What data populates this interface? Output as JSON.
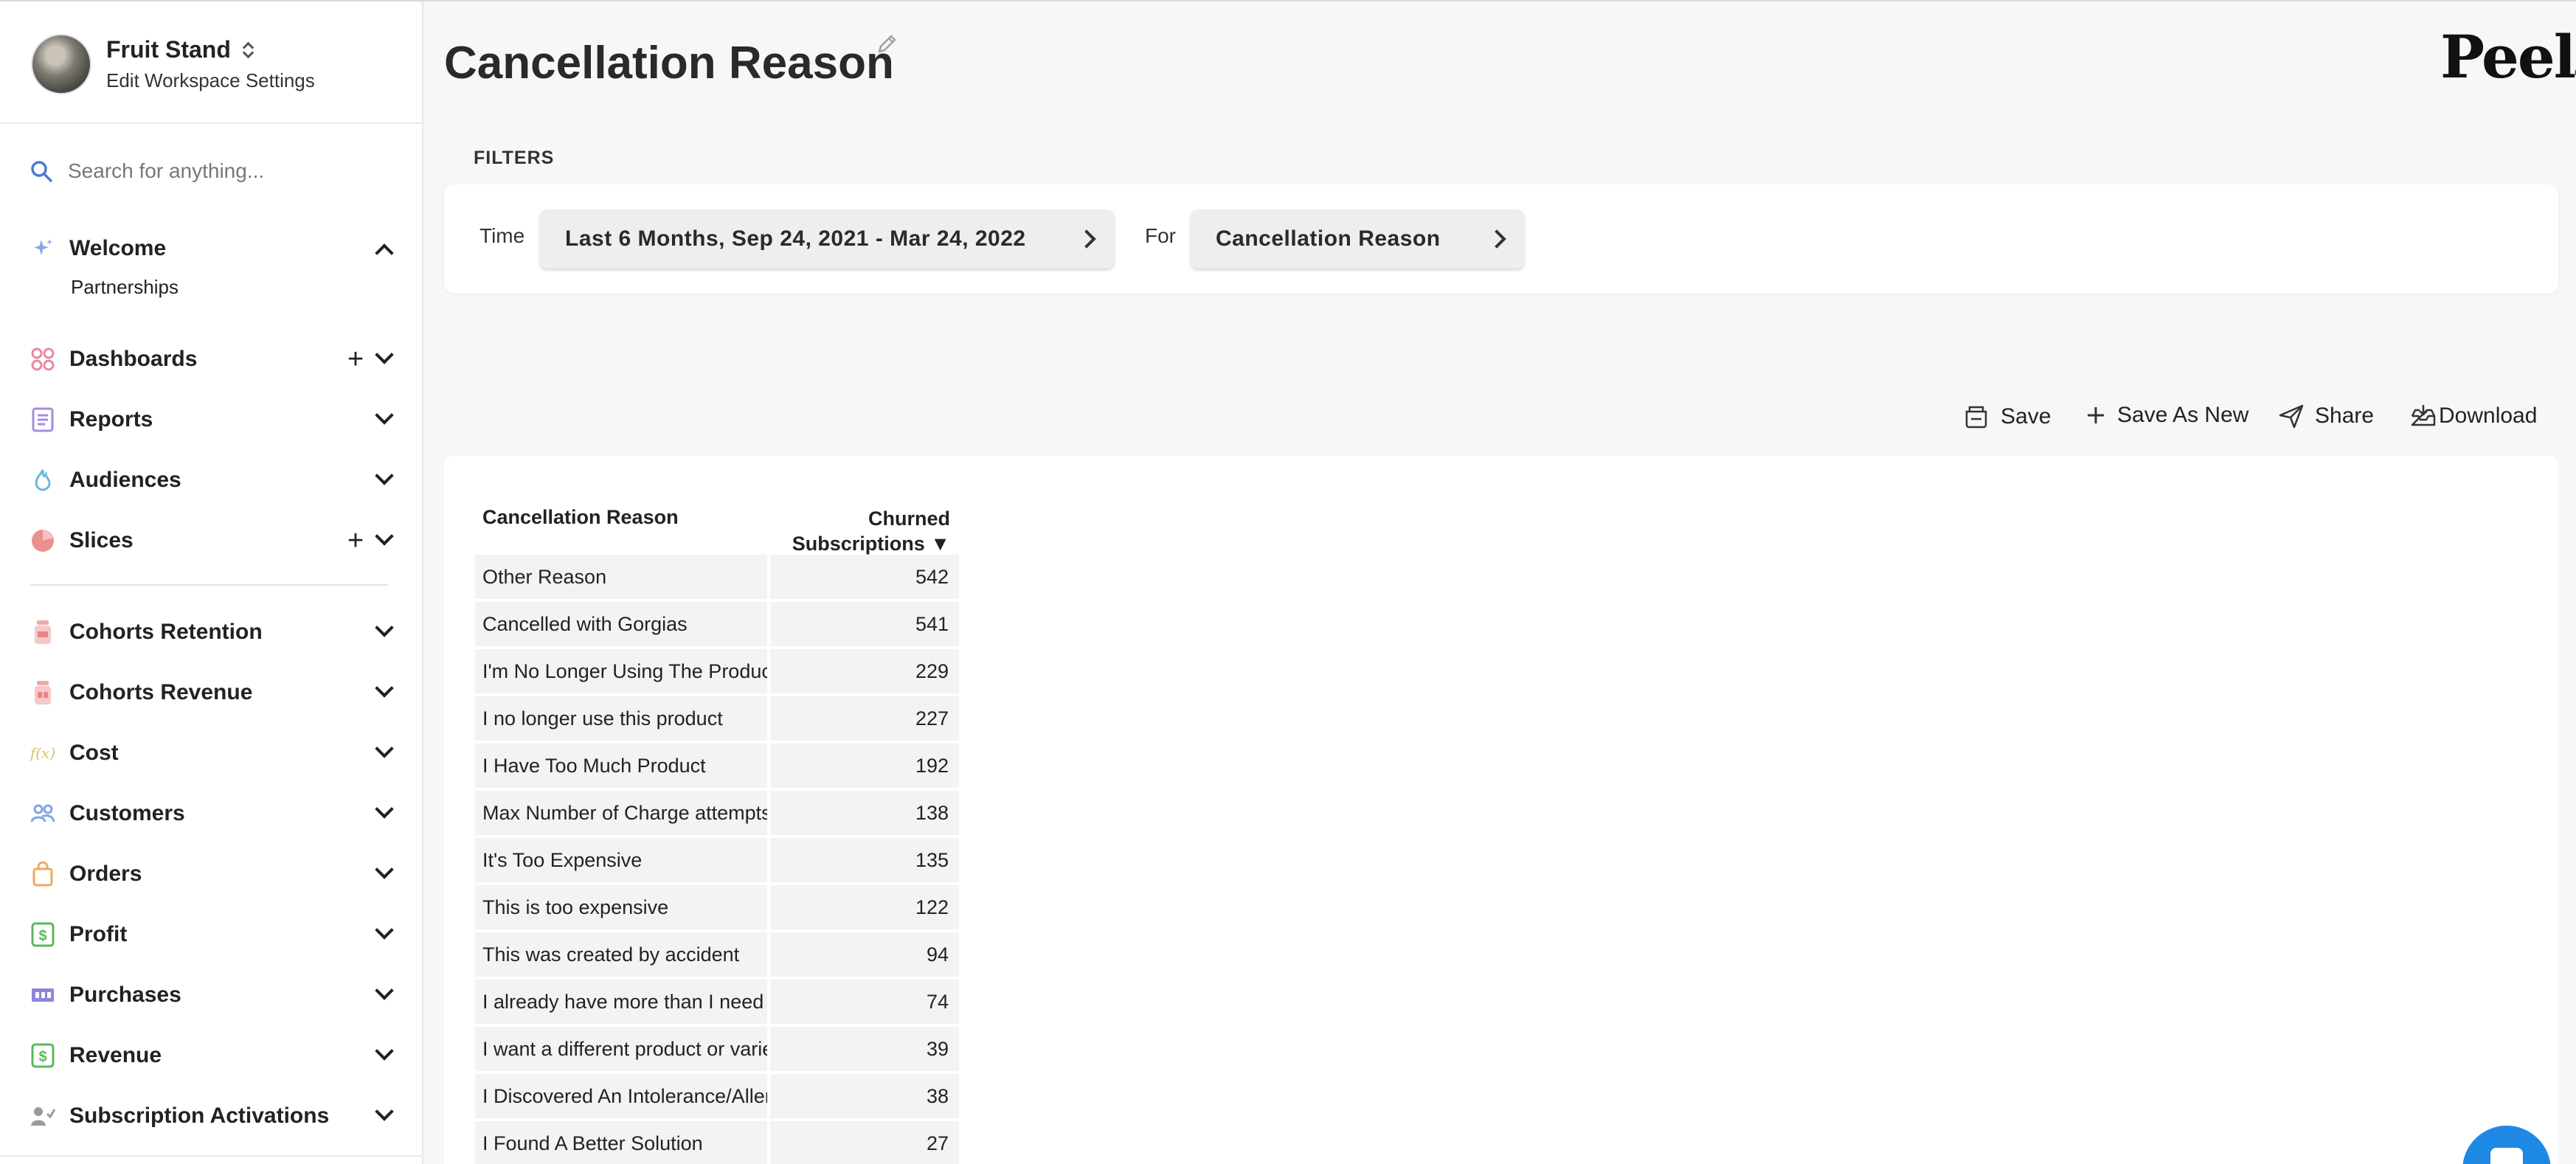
{
  "workspace": {
    "name": "Fruit Stand",
    "settings_link": "Edit Workspace Settings"
  },
  "search": {
    "placeholder": "Search for anything..."
  },
  "nav": {
    "welcome": {
      "label": "Welcome",
      "sub_items": [
        "Partnerships"
      ]
    },
    "dashboards": "Dashboards",
    "reports": "Reports",
    "audiences": "Audiences",
    "slices": "Slices",
    "cohorts_retention": "Cohorts Retention",
    "cohorts_revenue": "Cohorts Revenue",
    "cost": "Cost",
    "cost_icon_text": "f(x)",
    "customers": "Customers",
    "orders": "Orders",
    "profit": "Profit",
    "purchases": "Purchases",
    "revenue": "Revenue",
    "subscription_activations": "Subscription Activations",
    "plus_glyph": "+"
  },
  "page": {
    "title": "Cancellation Reason",
    "logo": "Peel"
  },
  "filters": {
    "section_label": "FILTERS",
    "time_label": "Time",
    "time_value": "Last 6 Months, Sep 24, 2021 - Mar 24, 2022",
    "for_label": "For",
    "for_value": "Cancellation Reason"
  },
  "actions": {
    "save": "Save",
    "save_as_new": "Save As New",
    "share": "Share",
    "download": "Download"
  },
  "table": {
    "col1": "Cancellation Reason",
    "col2_line1": "Churned",
    "col2_line2": "Subscriptions ▼",
    "rows": [
      {
        "reason": "Other Reason",
        "count": "542"
      },
      {
        "reason": "Cancelled with Gorgias",
        "count": "541"
      },
      {
        "reason": "I'm No Longer Using The Product",
        "count": "229"
      },
      {
        "reason": "I no longer use this product",
        "count": "227"
      },
      {
        "reason": "I Have Too Much Product",
        "count": "192"
      },
      {
        "reason": "Max Number of Charge attempts",
        "count": "138"
      },
      {
        "reason": "It's Too Expensive",
        "count": "135"
      },
      {
        "reason": "This is too expensive",
        "count": "122"
      },
      {
        "reason": "This was created by accident",
        "count": "94"
      },
      {
        "reason": "I already have more than I need",
        "count": "74"
      },
      {
        "reason": "I want a different product or variety",
        "count": "39"
      },
      {
        "reason": "I Discovered An Intolerance/Allergy",
        "count": "38"
      },
      {
        "reason": "I Found A Better Solution",
        "count": "27"
      }
    ]
  },
  "colors": {
    "accent_blue": "#1e88e5",
    "search_icon": "#4a7bd6"
  }
}
